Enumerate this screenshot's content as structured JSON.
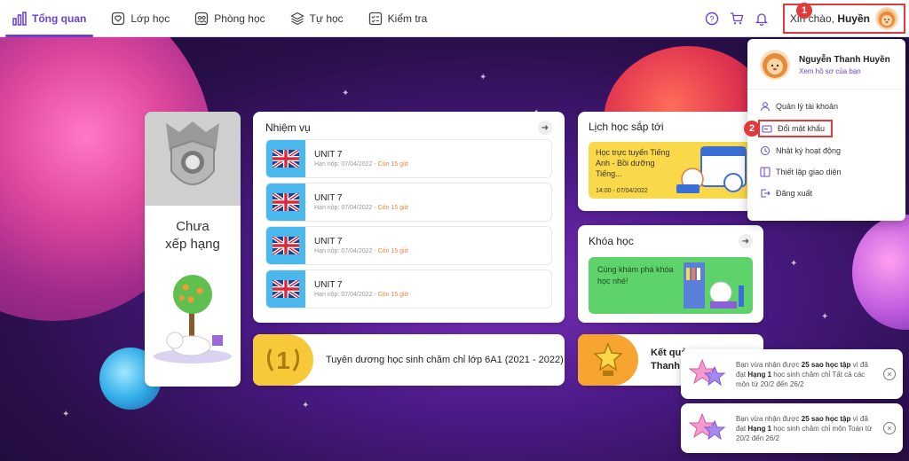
{
  "nav": {
    "items": [
      {
        "label": "Tổng quan",
        "icon": "overview-icon",
        "active": true
      },
      {
        "label": "Lớp học",
        "icon": "class-icon"
      },
      {
        "label": "Phòng học",
        "icon": "room-icon"
      },
      {
        "label": "Tự học",
        "icon": "self-study-icon"
      },
      {
        "label": "Kiểm tra",
        "icon": "test-icon"
      }
    ]
  },
  "header": {
    "greeting": "Xin chào,",
    "user_first_name": "Huyền",
    "annotation_1": "1",
    "annotation_2": "2"
  },
  "rank": {
    "line1": "Chưa",
    "line2": "xếp hạng"
  },
  "tasks": {
    "title": "Nhiệm vụ",
    "items": [
      {
        "title": "UNIT 7",
        "deadline": "Hạn nộp: 07/04/2022",
        "remaining": "Còn 15 giờ"
      },
      {
        "title": "UNIT 7",
        "deadline": "Hạn nộp: 07/04/2022",
        "remaining": "Còn 15 giờ"
      },
      {
        "title": "UNIT 7",
        "deadline": "Hạn nộp: 07/04/2022",
        "remaining": "Còn 15 giờ"
      },
      {
        "title": "UNIT 7",
        "deadline": "Hạn nộp: 07/04/2022",
        "remaining": "Còn 15 giờ"
      }
    ]
  },
  "award": {
    "text": "Tuyên dương học sinh chăm chỉ lớp 6A1 (2021 - 2022)"
  },
  "schedule": {
    "title": "Lịch học sắp tới",
    "banner_title": "Học trực tuyến Tiếng Anh - Bồi dưỡng Tiếng...",
    "time": "14:00 - 07/04/2022"
  },
  "course": {
    "title": "Khóa học",
    "banner_title": "Cùng khám phá khóa học nhé!"
  },
  "result": {
    "line1": "Kết quả",
    "line2": "Thanh"
  },
  "dropdown": {
    "name": "Nguyễn Thanh Huyền",
    "profile_link": "Xem hồ sơ của bạn",
    "items": [
      {
        "label": "Quản lý tài khoản"
      },
      {
        "label": "Đổi mật khẩu"
      },
      {
        "label": "Nhật ký hoạt động"
      },
      {
        "label": "Thiết lập giao diện"
      },
      {
        "label": "Đăng xuất"
      }
    ]
  },
  "toasts": [
    {
      "prefix": "Bạn vừa nhận được",
      "stars": "25 sao học tập",
      "mid": "vì đã đạt",
      "rank": "Hạng 1",
      "suffix": "học sinh chăm chỉ Tất cả các môn từ 20/2 đến 26/2"
    },
    {
      "prefix": "Bạn vừa nhận được",
      "stars": "25 sao học tập",
      "mid": "vì đã đạt",
      "rank": "Hạng 1",
      "suffix": "học sinh chăm chỉ môn Toán từ 20/2 đến 26/2"
    }
  ],
  "colors": {
    "accent": "#6b3fd6",
    "highlight": "#e03a3a",
    "task_flag_bg": "#4ab8ec",
    "schedule_bg": "#f9d84a",
    "course_bg": "#5fd36b"
  }
}
